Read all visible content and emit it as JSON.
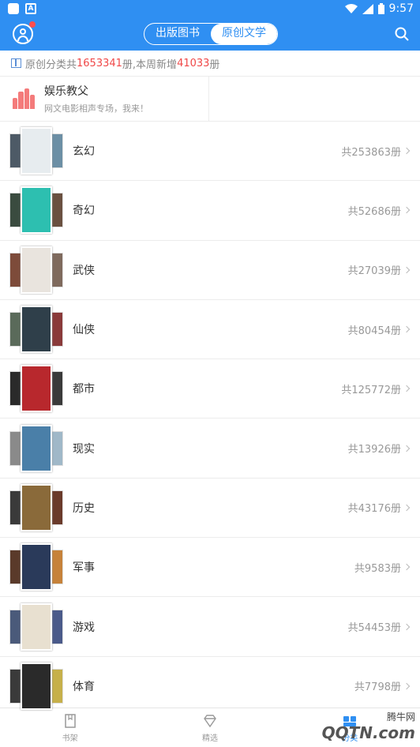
{
  "status": {
    "time": "9:57"
  },
  "header": {
    "tabs": [
      "出版图书",
      "原创文学"
    ],
    "active_tab": 1
  },
  "info": {
    "prefix": "原创分类共",
    "total": "1653341",
    "mid": "册,本周新增",
    "new": "41033",
    "suffix": "册"
  },
  "promo": {
    "title": "娱乐教父",
    "subtitle": "网文电影相声专场，我来！"
  },
  "categories": [
    {
      "name": "玄幻",
      "count": "共253863册",
      "colors": [
        "#4d5a66",
        "#e7ecef",
        "#6c8fa5"
      ]
    },
    {
      "name": "奇幻",
      "count": "共52686册",
      "colors": [
        "#3a4b3f",
        "#2dbfb0",
        "#6a5040"
      ]
    },
    {
      "name": "武侠",
      "count": "共27039册",
      "colors": [
        "#7d4b3a",
        "#e9e4de",
        "#7f6a5d"
      ]
    },
    {
      "name": "仙侠",
      "count": "共80454册",
      "colors": [
        "#5a6a5a",
        "#2f3f4a",
        "#8a3a3a"
      ]
    },
    {
      "name": "都市",
      "count": "共125772册",
      "colors": [
        "#2a2a2a",
        "#b8282d",
        "#3a3a3a"
      ]
    },
    {
      "name": "现实",
      "count": "共13926册",
      "colors": [
        "#8a8a8a",
        "#4a7fa8",
        "#a0b8c8"
      ]
    },
    {
      "name": "历史",
      "count": "共43176册",
      "colors": [
        "#3a3a3a",
        "#8a6a3a",
        "#6a3a2a"
      ]
    },
    {
      "name": "军事",
      "count": "共9583册",
      "colors": [
        "#5a3a2a",
        "#2a3a5a",
        "#c6823a"
      ]
    },
    {
      "name": "游戏",
      "count": "共54453册",
      "colors": [
        "#4a5a7a",
        "#e8e0d0",
        "#4a5a8a"
      ]
    },
    {
      "name": "体育",
      "count": "共7798册",
      "colors": [
        "#3a3a3a",
        "#2a2a2a",
        "#c6b04a"
      ]
    }
  ],
  "tabbar": {
    "items": [
      "书架",
      "精选",
      "分类"
    ],
    "active": 2
  },
  "watermark": {
    "text": "QQTN.com",
    "sub": "腾牛网"
  }
}
